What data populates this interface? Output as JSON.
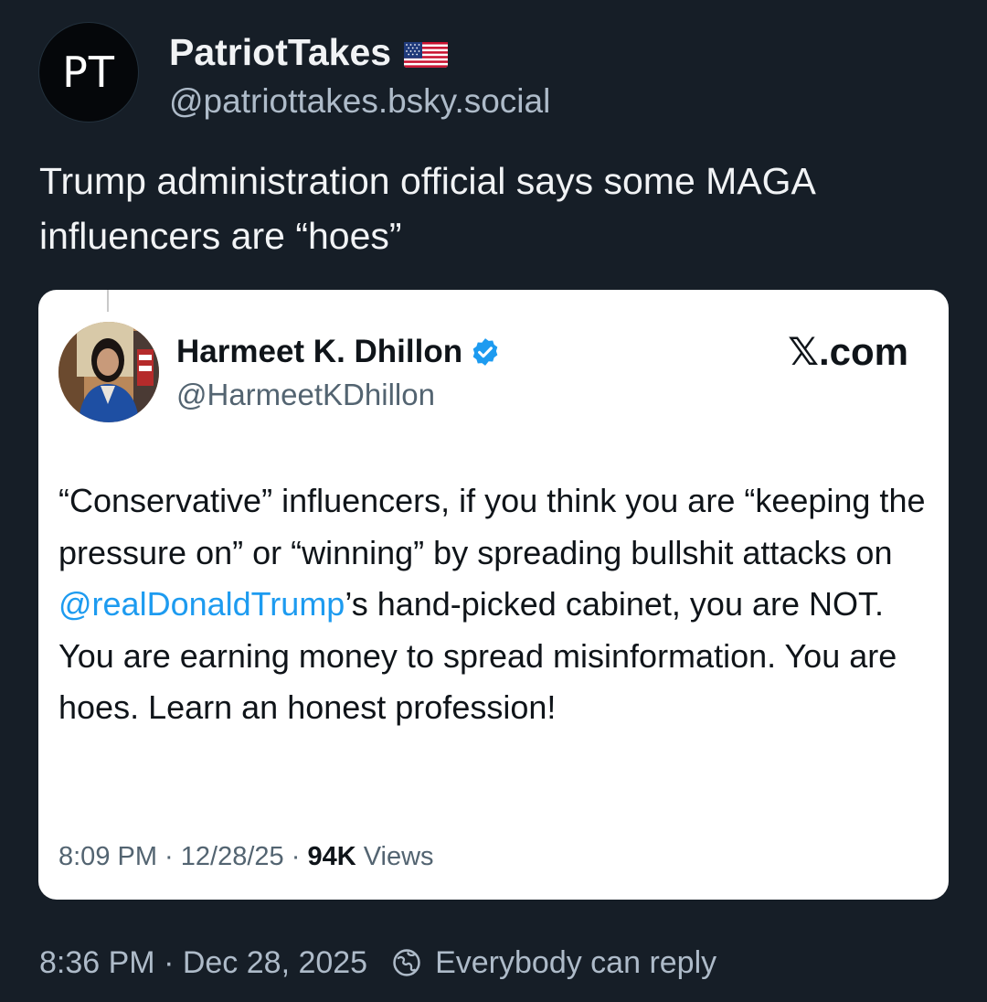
{
  "post": {
    "avatar_text": "PT",
    "display_name": "PatriotTakes",
    "flag_icon": "us-flag-icon",
    "handle": "@patriottakes.bsky.social",
    "text": "Trump administration official says some MAGA influencers are “hoes”",
    "timestamp": "8:36 PM · Dec 28, 2025",
    "reply_setting": "Everybody can reply"
  },
  "quoted_tweet": {
    "name": "Harmeet K. Dhillon",
    "handle": "@HarmeetKDhillon",
    "source": "𝕏.com",
    "text_before": "“Conservative” influencers, if you think you are “keeping the pressure on” or “winning” by spreading bullshit attacks on ",
    "mention": "@realDonaldTrump",
    "text_after": "’s hand-picked cabinet, you are NOT. You are earning money to spread misinformation. You are hoes. Learn an honest profession!",
    "meta_time": "8:09 PM · 12/28/25 · ",
    "views_count": "94K",
    "views_label": " Views"
  },
  "colors": {
    "background": "#161e27",
    "text_primary": "#f1f3f5",
    "text_secondary": "#aebbc9",
    "mention": "#1d9bf0",
    "verified": "#1d9bf0"
  }
}
